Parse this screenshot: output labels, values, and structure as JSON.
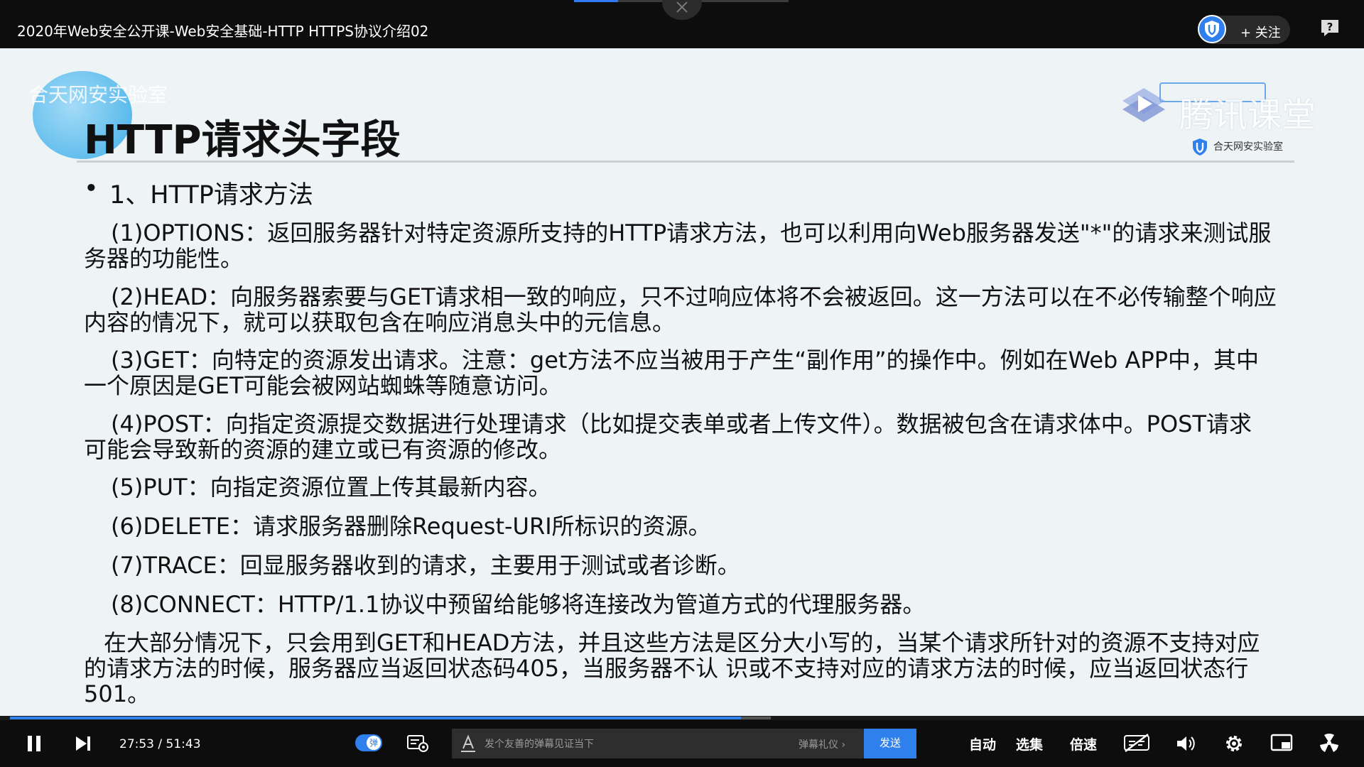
{
  "window": {
    "title": "2020年Web安全公开课-Web安全基础-HTTP HTTPS协议介绍02",
    "follow_label": "+ 关注"
  },
  "slide": {
    "logo_text": "合天网安实验室",
    "watermark": "腾讯课堂",
    "org_logo_text": "合天网安实验室",
    "title": "HTTP请求头字段",
    "bullet": "•",
    "heading": "1、HTTP请求方法",
    "paragraphs": [
      [
        "(1)OPTIONS：返回服务器针对特定资源所支持的HTTP请求方法，也可以利用向Web服务器发送\"*\"的请求来测试服",
        "务器的功能性。"
      ],
      [
        "(2)HEAD：向服务器索要与GET请求相一致的响应，只不过响应体将不会被返回。这一方法可以在不必传输整个响应",
        "内容的情况下，就可以获取包含在响应消息头中的元信息。"
      ],
      [
        "(3)GET：向特定的资源发出请求。注意：get方法不应当被用于产生“副作用”的操作中。例如在Web APP中，其中",
        "一个原因是GET可能会被网站蜘蛛等随意访问。"
      ],
      [
        "(4)POST：向指定资源提交数据进行处理请求（比如提交表单或者上传文件）。数据被包含在请求体中。POST请求",
        "可能会导致新的资源的建立或已有资源的修改。"
      ],
      [
        "(5)PUT：向指定资源位置上传其最新内容。"
      ],
      [
        "(6)DELETE：请求服务器删除Request-URI所标识的资源。"
      ],
      [
        "(7)TRACE：回显服务器收到的请求，主要用于测试或者诊断。"
      ],
      [
        "(8)CONNECT：HTTP/1.1协议中预留给能够将连接改为管道方式的代理服务器。"
      ],
      [
        "在大部分情况下，只会用到GET和HEAD方法，并且这些方法是区分大小写的，当某个请求所针对的资源不支持对应",
        "的请求方法的时候，服务器应当返回状态码405，当服务器不认 识或不支持对应的请求方法的时候，应当返回状态行",
        "501。"
      ]
    ]
  },
  "player": {
    "progress_fraction": 0.54,
    "buffered_fraction": 0.562,
    "current_time": "27:53",
    "separator": "/",
    "duration": "51:43",
    "danmu_toggle_label": "弹",
    "danmu_placeholder": "发个友善的弹幕见证当下",
    "danmu_etiquette": "弹幕礼仪 ›",
    "send_label": "发送",
    "auto_label": "自动",
    "episodes_label": "选集",
    "speed_label": "倍速"
  },
  "colors": {
    "accent": "#2f80ed",
    "bar": "#0d0d0d",
    "slide_bg": "#eef3f6"
  }
}
